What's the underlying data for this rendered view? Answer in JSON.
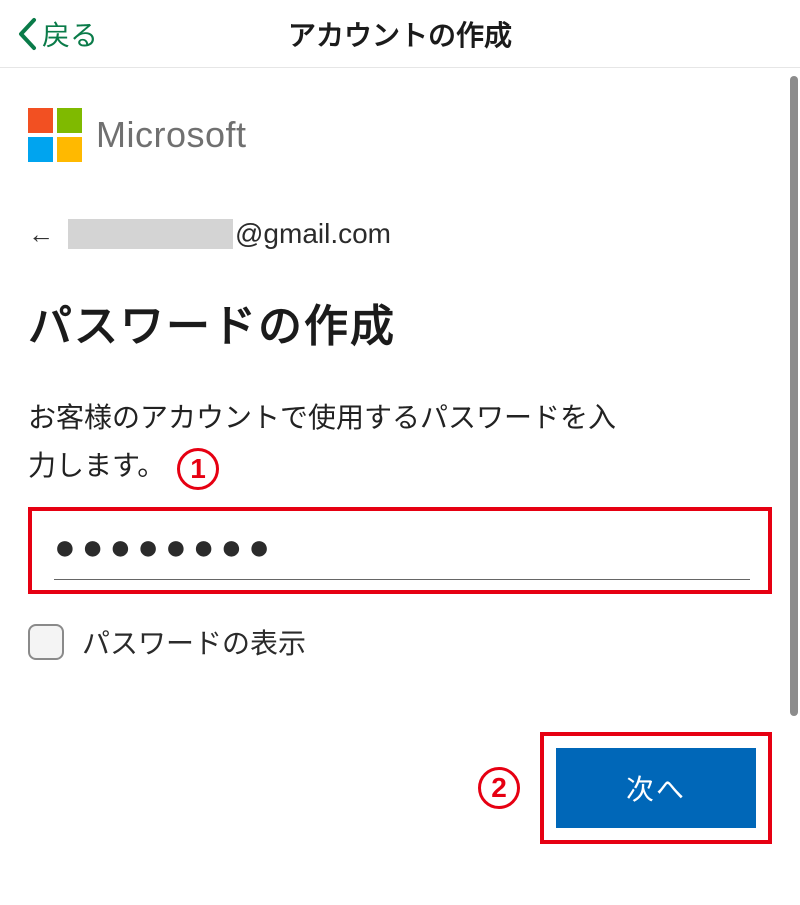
{
  "nav": {
    "back_label": "戻る",
    "title": "アカウントの作成"
  },
  "brand": {
    "name": "Microsoft"
  },
  "account": {
    "email_domain": "@gmail.com"
  },
  "main": {
    "heading": "パスワードの作成",
    "description_line1": "お客様のアカウントで使用するパスワードを入",
    "description_line2": "力します。",
    "password_value": "●●●●●●●●",
    "show_password_label": "パスワードの表示",
    "next_label": "次へ"
  },
  "annotations": {
    "step1": "1",
    "step2": "2"
  }
}
